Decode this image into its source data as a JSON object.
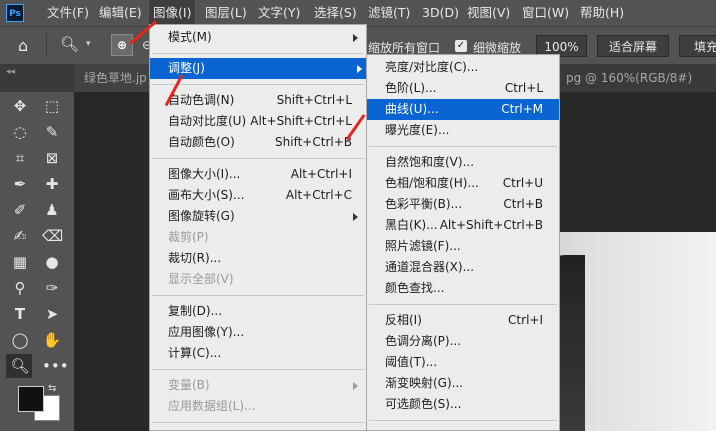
{
  "app": {
    "logo": "Ps"
  },
  "menubar": {
    "items": [
      "文件(F)",
      "编辑(E)",
      "图像(I)",
      "图层(L)",
      "文字(Y)",
      "选择(S)",
      "滤镜(T)",
      "3D(D)",
      "视图(V)",
      "窗口(W)",
      "帮助(H)"
    ]
  },
  "options": {
    "zoom_all_label": "缩放所有窗口",
    "scrubby_label": "细微缩放",
    "zoom_value": "100%",
    "fit_screen": "适合屏幕",
    "fill_screen": "填充"
  },
  "tabs": {
    "doc1": "绿色草地.jp",
    "doc2": "pg @ 160%(RGB/8#)"
  },
  "image_menu": {
    "items": [
      {
        "label": "模式(M)",
        "shortcut": "",
        "submenu": true,
        "disabled": false
      },
      {
        "label": "调整(J)",
        "shortcut": "",
        "submenu": true,
        "disabled": false,
        "highlight": true
      },
      {
        "label": "自动色调(N)",
        "shortcut": "Shift+Ctrl+L",
        "disabled": false
      },
      {
        "label": "自动对比度(U)",
        "shortcut": "Alt+Shift+Ctrl+L",
        "disabled": false
      },
      {
        "label": "自动颜色(O)",
        "shortcut": "Shift+Ctrl+B",
        "disabled": false
      },
      {
        "label": "图像大小(I)...",
        "shortcut": "Alt+Ctrl+I",
        "disabled": false
      },
      {
        "label": "画布大小(S)...",
        "shortcut": "Alt+Ctrl+C",
        "disabled": false
      },
      {
        "label": "图像旋转(G)",
        "shortcut": "",
        "submenu": true,
        "disabled": false
      },
      {
        "label": "裁剪(P)",
        "shortcut": "",
        "disabled": true
      },
      {
        "label": "裁切(R)...",
        "shortcut": "",
        "disabled": false
      },
      {
        "label": "显示全部(V)",
        "shortcut": "",
        "disabled": true
      },
      {
        "label": "复制(D)...",
        "shortcut": "",
        "disabled": false
      },
      {
        "label": "应用图像(Y)...",
        "shortcut": "",
        "disabled": false
      },
      {
        "label": "计算(C)...",
        "shortcut": "",
        "disabled": false
      },
      {
        "label": "变量(B)",
        "shortcut": "",
        "submenu": true,
        "disabled": true
      },
      {
        "label": "应用数据组(L)...",
        "shortcut": "",
        "disabled": true
      }
    ]
  },
  "adjust_menu": {
    "items": [
      {
        "label": "亮度/对比度(C)...",
        "shortcut": ""
      },
      {
        "label": "色阶(L)...",
        "shortcut": "Ctrl+L"
      },
      {
        "label": "曲线(U)...",
        "shortcut": "Ctrl+M",
        "highlight": true
      },
      {
        "label": "曝光度(E)...",
        "shortcut": ""
      },
      {
        "label": "自然饱和度(V)...",
        "shortcut": ""
      },
      {
        "label": "色相/饱和度(H)...",
        "shortcut": "Ctrl+U"
      },
      {
        "label": "色彩平衡(B)...",
        "shortcut": "Ctrl+B"
      },
      {
        "label": "黑白(K)...",
        "shortcut": "Alt+Shift+Ctrl+B"
      },
      {
        "label": "照片滤镜(F)...",
        "shortcut": ""
      },
      {
        "label": "通道混合器(X)...",
        "shortcut": ""
      },
      {
        "label": "颜色查找...",
        "shortcut": ""
      },
      {
        "label": "反相(I)",
        "shortcut": "Ctrl+I"
      },
      {
        "label": "色调分离(P)...",
        "shortcut": ""
      },
      {
        "label": "阈值(T)...",
        "shortcut": ""
      },
      {
        "label": "渐变映射(G)...",
        "shortcut": ""
      },
      {
        "label": "可选颜色(S)...",
        "shortcut": ""
      }
    ]
  },
  "colors": {
    "highlight": "#0a64d2",
    "annotation": "#e5261f"
  }
}
